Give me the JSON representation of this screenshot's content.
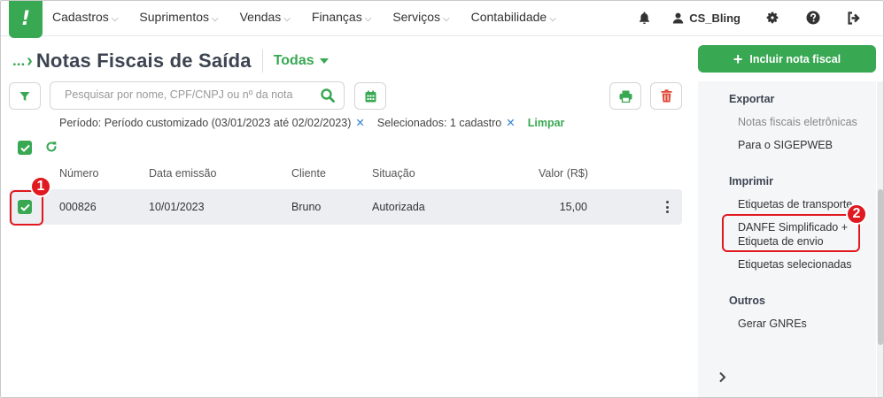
{
  "nav": {
    "logo": "!",
    "items": [
      {
        "label": "Cadastros"
      },
      {
        "label": "Suprimentos"
      },
      {
        "label": "Vendas"
      },
      {
        "label": "Finanças"
      },
      {
        "label": "Serviços"
      },
      {
        "label": "Contabilidade"
      }
    ],
    "user": "CS_Bling"
  },
  "header": {
    "breadcrumb_dots": "...",
    "title": "Notas Fiscais de Saída",
    "filter": "Todas"
  },
  "search": {
    "placeholder": "Pesquisar por nome, CPF/CNPJ ou nº da nota",
    "value": ""
  },
  "filters": {
    "periodo": "Período: Período customizado (03/01/2023 até 02/02/2023)",
    "selecionados": "Selecionados: 1 cadastro",
    "limpar": "Limpar",
    "remove_glyph": "✕"
  },
  "table": {
    "headers": [
      "Número",
      "Data emissão",
      "Cliente",
      "Situação",
      "Valor (R$)"
    ],
    "rows": [
      {
        "numero": "000826",
        "data": "10/01/2023",
        "cliente": "Bruno",
        "situacao": "Autorizada",
        "valor": "15,00",
        "checked": true
      }
    ]
  },
  "sidebar": {
    "primary_button": "Incluir nota fiscal",
    "sections": [
      {
        "title": "Exportar",
        "items": [
          "Notas fiscais eletrônicas",
          "Para o SIGEPWEB"
        ]
      },
      {
        "title": "Imprimir",
        "items": [
          "Etiquetas de transporte",
          "DANFE Simplificado + Etiqueta de envio",
          "Etiquetas selecionadas"
        ]
      },
      {
        "title": "Outros",
        "items": [
          "Gerar GNREs"
        ]
      }
    ],
    "danfe_line1": "DANFE Simplificado +",
    "danfe_line2": "Etiqueta de envio"
  },
  "annotations": {
    "step1": "1",
    "step2": "2"
  },
  "colors": {
    "brand_green": "#39a853",
    "highlight_red": "#e0181f",
    "delete_red": "#e04a3a",
    "link_blue": "#2c7fd1"
  },
  "icons": [
    "bell-icon",
    "user-icon",
    "gear-icon",
    "help-icon",
    "logout-icon",
    "filter-icon",
    "search-icon",
    "calendar-icon",
    "print-icon",
    "trash-icon",
    "check-icon",
    "refresh-icon",
    "kebab-icon",
    "chevron-right-icon"
  ]
}
